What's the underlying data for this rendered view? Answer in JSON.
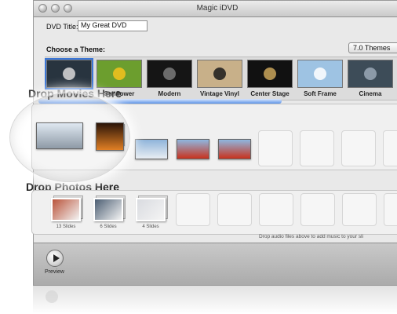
{
  "window": {
    "title": "Magic iDVD"
  },
  "dvd_title": {
    "label": "DVD Title:",
    "value": "My Great DVD"
  },
  "themes": {
    "label": "Choose a Theme:",
    "set_selector": "7.0 Themes",
    "items": [
      {
        "label": "",
        "thumb_bg": "#28343f",
        "accent": "#d9d9d9"
      },
      {
        "label": "Sunflower",
        "thumb_bg": "#6c9e2e",
        "accent": "#f4c21c"
      },
      {
        "label": "Modern",
        "thumb_bg": "#151515",
        "accent": "#7a7a7a"
      },
      {
        "label": "Vintage Vinyl",
        "thumb_bg": "#c8b089",
        "accent": "#1b1b1b"
      },
      {
        "label": "Center Stage",
        "thumb_bg": "#111111",
        "accent": "#c9a55a"
      },
      {
        "label": "Soft Frame",
        "thumb_bg": "#9ec3e3",
        "accent": "#ffffff"
      },
      {
        "label": "Cinema",
        "thumb_bg": "#3d4c58",
        "accent": "#9aa8b6"
      }
    ]
  },
  "movies": {
    "title": "Drop Movies Here",
    "clips": [
      {
        "top": "#dfe8f1",
        "bottom": "#8e9aa6"
      },
      {
        "top": "#2a1408",
        "bottom": "#e07f24"
      },
      {
        "top": "#cfe0f0",
        "bottom": "#a7b4bf"
      },
      {
        "top": "#8fb4da",
        "bottom": "#e9eef3"
      },
      {
        "top": "#8fb7e0",
        "bottom": "#c8321e"
      }
    ]
  },
  "photos": {
    "title": "Drop Photos Here",
    "albums": [
      {
        "count": "13 Slides",
        "color": "#b9533a"
      },
      {
        "count": "6 Slides",
        "color": "#4c5e73"
      },
      {
        "count": "4 Slides",
        "color": "#d9dbe0"
      }
    ]
  },
  "hint": "Drop audio files above to add music to your sli",
  "preview_label": "Preview",
  "colors": {
    "selection": "#3b76d6",
    "progress": "#5d93e6"
  }
}
